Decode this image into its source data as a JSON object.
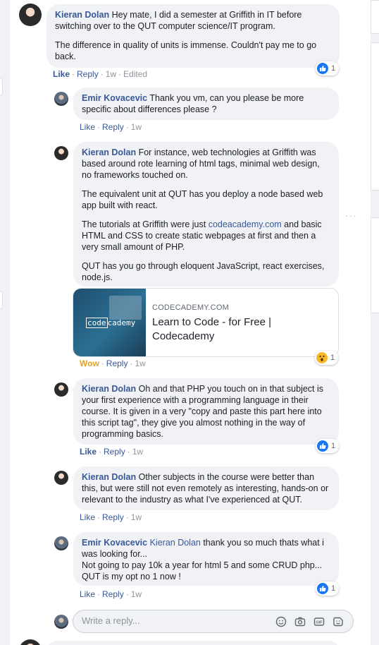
{
  "comments": [
    {
      "author": "Kieran Dolan",
      "paragraphs": [
        "Hey mate, I did a semester at Griffith in IT before switching over to the QUT computer science/IT program.",
        "The difference in quality of units is immense. Couldn't pay me to go back."
      ],
      "actions": {
        "like": "Like",
        "reply": "Reply",
        "time": "1w",
        "edited": "Edited"
      },
      "reaction_count": "1"
    }
  ],
  "replies": [
    {
      "author": "Emir Kovacevic",
      "text": "Thank you vm, can you please be more specific about differences please ?",
      "actions": {
        "like": "Like",
        "reply": "Reply",
        "time": "1w"
      }
    },
    {
      "author": "Kieran Dolan",
      "p1": "For instance, web technologies at Griffith was based around rote learning of html tags, minimal web design, no frameworks touched on.",
      "p2": "The equivalent unit at QUT has you deploy a node based web app built with react.",
      "p3_before": "The tutorials at Griffith were just ",
      "p3_link": "codeacademy.com",
      "p3_after": " and basic HTML and CSS to create static webpages at first and then a very small amount of PHP.",
      "p4": "QUT has you go through eloquent JavaScript, react exercises, node.js.",
      "link_card": {
        "domain": "CODECADEMY.COM",
        "title": "Learn to Code - for Free | Codecademy",
        "logo_box": "code",
        "logo_rest": "cademy"
      },
      "actions": {
        "reaction": "Wow",
        "reply": "Reply",
        "time": "1w"
      },
      "reaction_count": "1"
    },
    {
      "author": "Kieran Dolan",
      "text": "Oh and that PHP you touch on in that subject is your first experience with a programming language in their course. It is given in a very \"copy and paste this part here into this script tag\", they give you almost nothing in the way of programming basics.",
      "actions": {
        "like": "Like",
        "reply": "Reply",
        "time": "1w"
      },
      "reaction_count": "1"
    },
    {
      "author": "Kieran Dolan",
      "text": "Other subjects in the course were better than this, but were still not even remotely as interesting, hands-on or relevant to the industry as what I've experienced at QUT.",
      "actions": {
        "like": "Like",
        "reply": "Reply",
        "time": "1w"
      }
    },
    {
      "author": "Emir Kovacevic",
      "mention": "Kieran Dolan",
      "text": " thank you so much thats what i was looking for...",
      "line2": "Not going to pay 10k a year for html 5 and some CRUD php...",
      "line3": "QUT is my opt no 1 now !",
      "actions": {
        "like": "Like",
        "reply": "Reply",
        "time": "1w"
      },
      "reaction_count": "1"
    }
  ],
  "reply_input": {
    "placeholder": "Write a reply..."
  },
  "more_menu": "···",
  "icons": [
    "like-icon",
    "wow-icon",
    "smiley-icon",
    "camera-icon",
    "gif-icon",
    "sticker-icon"
  ],
  "colors": {
    "link": "#385898",
    "like_blue": "#1877f2",
    "wow_yellow": "#f7b928",
    "bubble_bg": "#f0f2f5"
  }
}
